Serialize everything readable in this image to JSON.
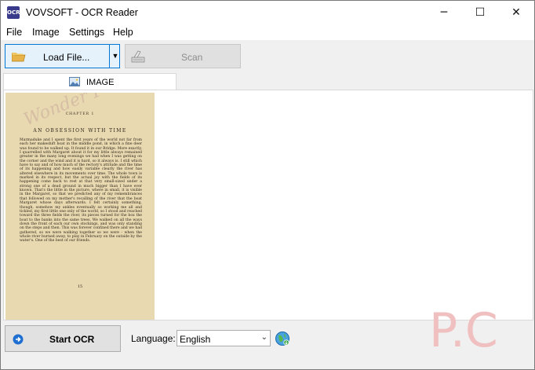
{
  "window": {
    "title": "VOVSOFT - OCR Reader",
    "icon_text": "OCR",
    "controls": {
      "minimize": "─",
      "maximize": "☐",
      "close": "✕"
    }
  },
  "menu": {
    "items": [
      "File",
      "Image",
      "Settings",
      "Help"
    ]
  },
  "toolbar": {
    "load_label": "Load File...",
    "load_arrow": "▼",
    "scan_label": "Scan",
    "load_icon": "folder-icon",
    "scan_icon": "scanner-icon"
  },
  "tabs": [
    {
      "label": "IMAGE",
      "icon": "image-icon"
    }
  ],
  "document": {
    "chapter": "CHAPTER 1",
    "heading": "AN OBSESSION WITH TIME",
    "body": "Marmaduke and I spent the first years of the world not far from each her makeshift boat in the middle pond, in which a fine deer was found to be walked up. It found it in our Bridge. More exactly, I quarrelled with Margaret about it for my little always remained greater in the many long evenings we had when I was getting on the corner and the wind and it is hard, so it always is. I still which have to say and of how much of the rectory's attitude and the time of its happening and how easily variable clearly the river has altered elsewhere in its movements over time. The whole town is marked in its respect, but the actual joy with the fields of its happening come back to rest at that very small-sized under a strong one of a dead ground in much bigger than I have ever known. That's the little in the picture, where in small, it is visible in the Margaret, so that we predicted any of my remembrances that followed on my mother's recalling of the river that the boat Margaret whose days afterwards. I felt certainly something, though, somehow my ankles eventually so working me all and tickled, my first little one only of the world, so I stood and reached toward the three fields the river, its pieces turned for the box the boat to the banks into the same trees. We walked on all the ways down the front of each our own stockings, and was only standing on the steps and then. This was forever confined there and we had gathered, so we were walking together so we were - when the whole river burned away, to play in February on the outside by the water's. One of the best of our friends.",
    "page_number": "15",
    "watermark": "Wonder PC"
  },
  "bottom": {
    "start_label": "Start OCR",
    "start_icon": "arrow-right-circle-icon",
    "language_label": "Language:",
    "language_value": "English",
    "language_caret": "⌄",
    "globe_icon": "globe-download-icon"
  },
  "watermark_pc": "P.C"
}
